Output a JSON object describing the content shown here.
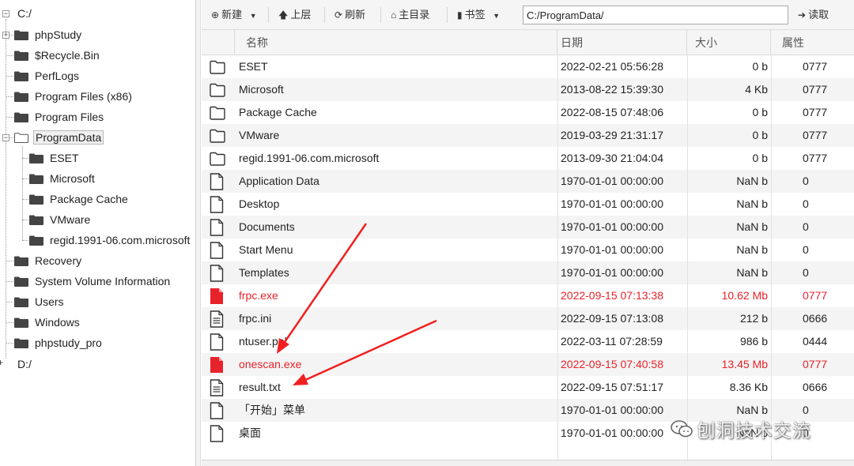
{
  "tree": {
    "root_c": "C:/",
    "root_d": "D:/",
    "items_level1": [
      "phpStudy",
      "$Recycle.Bin",
      "PerfLogs",
      "Program Files (x86)",
      "Program Files",
      "ProgramData"
    ],
    "items_level2": [
      "ESET",
      "Microsoft",
      "Package Cache",
      "VMware",
      "regid.1991-06.com.microsoft"
    ],
    "items_after": [
      "Recovery",
      "System Volume Information",
      "Users",
      "Windows",
      "phpstudy_pro"
    ],
    "selected": "ProgramData"
  },
  "toolbar": {
    "new_label": "新建",
    "up_label": "上层",
    "refresh_label": "刷新",
    "home_label": "主目录",
    "bookmark_label": "书签",
    "path_value": "C:/ProgramData/",
    "read_label": "读取"
  },
  "grid": {
    "columns": [
      "名称",
      "日期",
      "大小",
      "属性"
    ],
    "rows": [
      {
        "type": "folder",
        "name": "ESET",
        "date": "2022-02-21 05:56:28",
        "size": "0 b",
        "attr": "0777",
        "highlight": false
      },
      {
        "type": "folder",
        "name": "Microsoft",
        "date": "2013-08-22 15:39:30",
        "size": "4 Kb",
        "attr": "0777",
        "highlight": false
      },
      {
        "type": "folder",
        "name": "Package Cache",
        "date": "2022-08-15 07:48:06",
        "size": "0 b",
        "attr": "0777",
        "highlight": false
      },
      {
        "type": "folder",
        "name": "VMware",
        "date": "2019-03-29 21:31:17",
        "size": "0 b",
        "attr": "0777",
        "highlight": false
      },
      {
        "type": "folder",
        "name": "regid.1991-06.com.microsoft",
        "date": "2013-09-30 21:04:04",
        "size": "0 b",
        "attr": "0777",
        "highlight": false
      },
      {
        "type": "file",
        "name": "Application Data",
        "date": "1970-01-01 00:00:00",
        "size": "NaN b",
        "attr": "0",
        "highlight": false
      },
      {
        "type": "file",
        "name": "Desktop",
        "date": "1970-01-01 00:00:00",
        "size": "NaN b",
        "attr": "0",
        "highlight": false
      },
      {
        "type": "file",
        "name": "Documents",
        "date": "1970-01-01 00:00:00",
        "size": "NaN b",
        "attr": "0",
        "highlight": false
      },
      {
        "type": "file",
        "name": "Start Menu",
        "date": "1970-01-01 00:00:00",
        "size": "NaN b",
        "attr": "0",
        "highlight": false
      },
      {
        "type": "file",
        "name": "Templates",
        "date": "1970-01-01 00:00:00",
        "size": "NaN b",
        "attr": "0",
        "highlight": false
      },
      {
        "type": "exe",
        "name": "frpc.exe",
        "date": "2022-09-15 07:13:38",
        "size": "10.62 Mb",
        "attr": "0777",
        "highlight": true
      },
      {
        "type": "text",
        "name": "frpc.ini",
        "date": "2022-09-15 07:13:08",
        "size": "212 b",
        "attr": "0666",
        "highlight": false
      },
      {
        "type": "file",
        "name": "ntuser.pol",
        "date": "2022-03-11 07:28:59",
        "size": "986 b",
        "attr": "0444",
        "highlight": false
      },
      {
        "type": "exe",
        "name": "onescan.exe",
        "date": "2022-09-15 07:40:58",
        "size": "13.45 Mb",
        "attr": "0777",
        "highlight": true
      },
      {
        "type": "text",
        "name": "result.txt",
        "date": "2022-09-15 07:51:17",
        "size": "8.36 Kb",
        "attr": "0666",
        "highlight": false
      },
      {
        "type": "file",
        "name": "「开始」菜单",
        "date": "1970-01-01 00:00:00",
        "size": "NaN b",
        "attr": "0",
        "highlight": false
      },
      {
        "type": "file",
        "name": "桌面",
        "date": "1970-01-01 00:00:00",
        "size": "NaN b",
        "attr": "0",
        "highlight": false
      }
    ]
  },
  "watermark": "刨洞技术交流",
  "colors": {
    "highlight_red": "#e8222a",
    "arrow_red": "#f02020",
    "header_bg": "#f5f5f5",
    "stripe_bg": "#f4f4f4"
  },
  "icons": {
    "folder_tree": "folder-filled-icon",
    "folder_grid": "folder-outline-icon",
    "file": "file-icon",
    "text": "text-file-icon",
    "exe": "exe-file-icon"
  }
}
